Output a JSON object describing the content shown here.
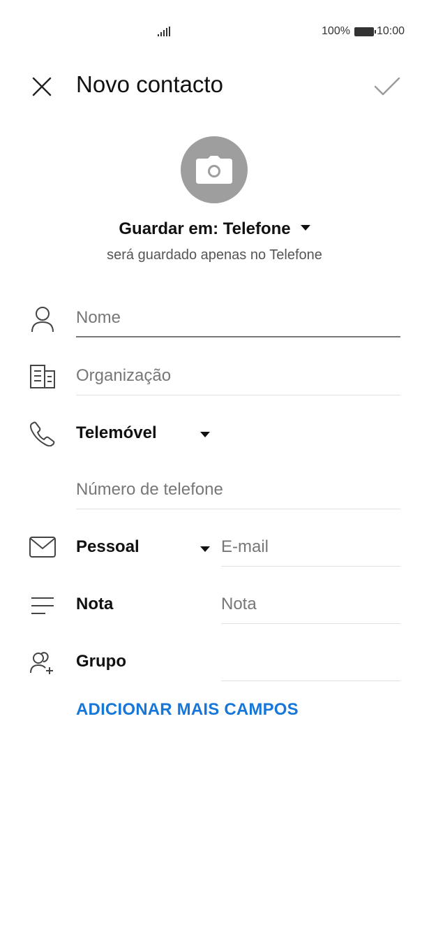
{
  "status_bar": {
    "battery_percent": "100%",
    "time": "10:00"
  },
  "header": {
    "title": "Novo contacto"
  },
  "save_location": {
    "label": "Guardar em: Telefone",
    "subtitle": "será guardado apenas no Telefone"
  },
  "fields": {
    "name": {
      "placeholder": "Nome"
    },
    "organization": {
      "placeholder": "Organização"
    },
    "phone": {
      "type_label": "Telemóvel",
      "placeholder": "Número de telefone"
    },
    "email": {
      "type_label": "Pessoal",
      "placeholder": "E-mail"
    },
    "note": {
      "label": "Nota",
      "placeholder": "Nota"
    },
    "group": {
      "label": "Grupo",
      "value": ""
    }
  },
  "add_more_fields": "ADICIONAR MAIS CAMPOS",
  "colors": {
    "accent": "#1677d9",
    "photo_bg": "#9e9e9e"
  }
}
